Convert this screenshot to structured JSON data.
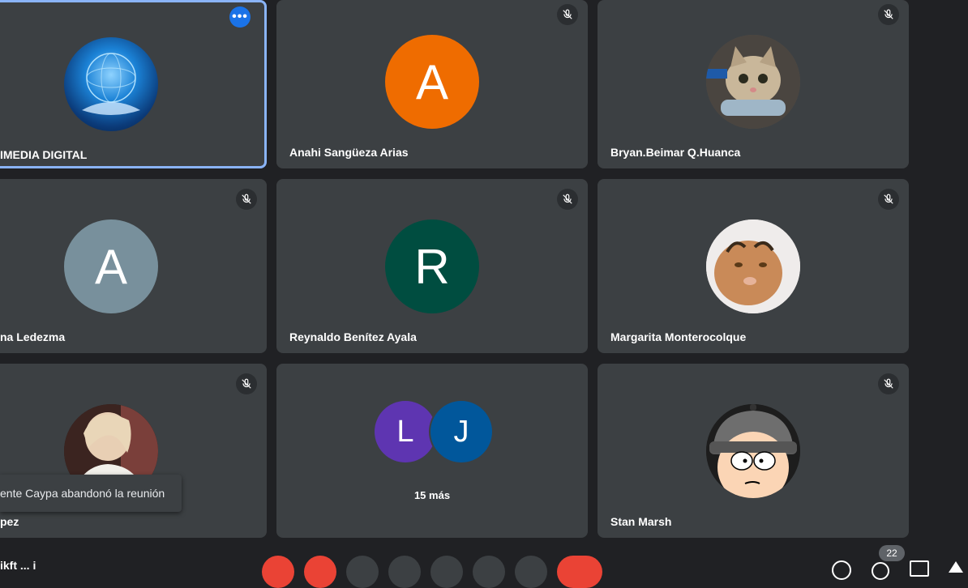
{
  "colors": {
    "background": "#202124",
    "tile": "#3c4043",
    "active_border": "#8ab4f8",
    "avatar_anahi": "#ef6c00",
    "avatar_a2": "#78909c",
    "avatar_reynaldo": "#004d40",
    "avatar_l": "#5e35b1",
    "avatar_j": "#01579b",
    "leave_red": "#ea4335"
  },
  "tiles": [
    {
      "name": "IMEDIA DIGITAL",
      "avatar_type": "globe-image",
      "muted": false,
      "more_options": true,
      "active": true
    },
    {
      "name": "Anahi Sangüeza Arias",
      "avatar_letter": "A",
      "muted": true
    },
    {
      "name": "Bryan.Beimar Q.Huanca",
      "avatar_type": "cat-photo",
      "muted": true
    },
    {
      "name": "na Ledezma",
      "avatar_letter": "A",
      "muted": true
    },
    {
      "name": "Reynaldo Benítez Ayala",
      "avatar_letter": "R",
      "muted": true
    },
    {
      "name": "Margarita Monterocolque",
      "avatar_type": "cat-photo",
      "muted": true
    },
    {
      "name": "pez",
      "avatar_type": "anime-image",
      "muted": true
    },
    {
      "name": "15 más",
      "avatar_letters": [
        "L",
        "J"
      ]
    },
    {
      "name": "Stan Marsh",
      "avatar_type": "cartoon-image",
      "muted": true
    }
  ],
  "toast": {
    "text": "ente Caypa abandonó la reunión"
  },
  "bottom": {
    "meeting_code_partial": "ikft ... i",
    "participant_count": "22"
  },
  "icons": {
    "mute": "mic-off-icon",
    "more": "more-horiz-icon"
  }
}
